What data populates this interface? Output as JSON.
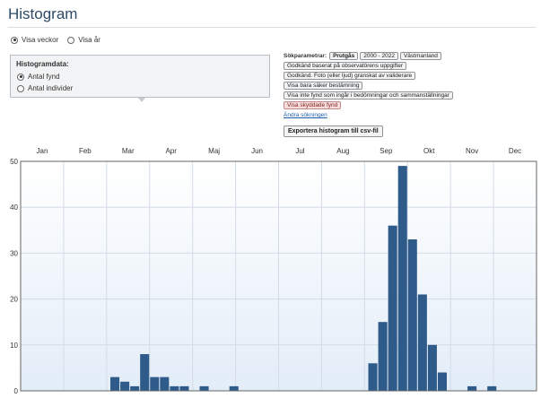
{
  "page": {
    "title": "Histogram"
  },
  "period": {
    "options": [
      {
        "label": "Visa veckor",
        "checked": true
      },
      {
        "label": "Visa år",
        "checked": false
      }
    ]
  },
  "histogram_box": {
    "title": "Histogramdata:",
    "options": [
      {
        "label": "Antal fynd",
        "checked": true
      },
      {
        "label": "Antal individer",
        "checked": false
      }
    ]
  },
  "search_params": {
    "label": "Sökparametrar:",
    "chips_row1": [
      "Prutgås",
      "2000 - 2022",
      "Västmanland"
    ],
    "chips": [
      "Godkänd baserat på observatörens uppgifter",
      "Godkänd. Foto (eller ljud) granskat av validerare",
      "Visa bara säker bestämning",
      "Visa inte fynd som ingår i bedömningar och sammanställningar"
    ],
    "warn_chip": "Visa skyddade fynd",
    "change_link": "Ändra sökningen"
  },
  "export_button": "Exportera histogram till csv-fil",
  "colors": {
    "bar": "#2f5b8a",
    "plot_bg_top": "#ffffff",
    "plot_bg_bottom": "#e3edf8",
    "grid": "#d3dce6"
  },
  "chart_data": {
    "type": "bar",
    "months": [
      "Jan",
      "Feb",
      "Mar",
      "Apr",
      "Maj",
      "Jun",
      "Jul",
      "Aug",
      "Sep",
      "Okt",
      "Nov",
      "Dec"
    ],
    "ylim": [
      0,
      50
    ],
    "yticks": [
      0,
      10,
      20,
      30,
      40,
      50
    ],
    "weeks": [
      1,
      2,
      3,
      4,
      5,
      6,
      7,
      8,
      9,
      10,
      11,
      12,
      13,
      14,
      15,
      16,
      17,
      18,
      19,
      20,
      21,
      22,
      23,
      24,
      25,
      26,
      27,
      28,
      29,
      30,
      31,
      32,
      33,
      34,
      35,
      36,
      37,
      38,
      39,
      40,
      41,
      42,
      43,
      44,
      45,
      46,
      47,
      48,
      49,
      50,
      51,
      52
    ],
    "values": [
      0,
      0,
      0,
      0,
      0,
      0,
      0,
      0,
      0,
      3,
      2,
      1,
      8,
      3,
      3,
      1,
      1,
      0,
      1,
      0,
      0,
      1,
      0,
      0,
      0,
      0,
      0,
      0,
      0,
      0,
      0,
      0,
      0,
      0,
      0,
      6,
      15,
      36,
      49,
      33,
      21,
      10,
      4,
      0,
      0,
      1,
      0,
      1,
      0,
      0,
      0,
      0
    ]
  }
}
